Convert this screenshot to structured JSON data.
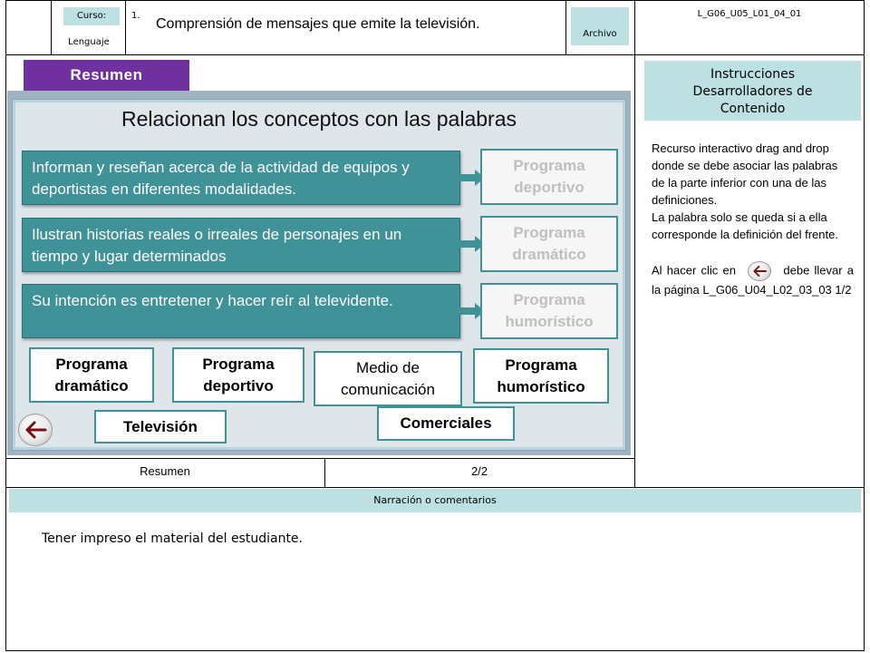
{
  "header": {
    "curso_label": "Curso:",
    "curso_value": "Lenguaje",
    "number": "1.",
    "title": "Comprensión de mensajes que emite la televisión.",
    "archivo_label": "Archivo",
    "code": "L_G06_U05_L01_04_01"
  },
  "slide": {
    "tab_label": "Resumen",
    "title": "Relacionan los conceptos con las palabras",
    "concepts": [
      "Informan y reseñan acerca de la actividad de equipos y deportistas en diferentes modalidades.",
      "Ilustran historias reales o irreales de personajes en un tiempo y lugar determinados",
      "Su intención es entretener y hacer reír al televidente."
    ],
    "targets": [
      "Programa deportivo",
      "Programa dramático",
      "Programa humorístico"
    ],
    "words": [
      "Programa dramático",
      "Programa deportivo",
      "Medio de comunicación",
      "Programa humorístico",
      "Televisión",
      "Comerciales"
    ],
    "back_icon": "back-arrow-icon"
  },
  "instructions": {
    "title": "Instrucciones Desarrolladores de Contenido",
    "p1": "Recurso interactivo drag and drop donde se debe asociar las palabras de la parte inferior con una de las definiciones.",
    "p2": "La palabra solo se queda si a ella corresponde la definición del frente.",
    "p3_before": "Al hacer clic en",
    "p3_after": "debe llevar a la página L_G06_U04_L02_03_03 1/2"
  },
  "footer": {
    "section": "Resumen",
    "page": "2/2"
  },
  "narration": {
    "title": "Narración o comentarios",
    "text": "Tener impreso el material del estudiante."
  },
  "colors": {
    "teal": "#3e9298",
    "light_blue": "#bde0e3",
    "purple": "#7030a0"
  }
}
